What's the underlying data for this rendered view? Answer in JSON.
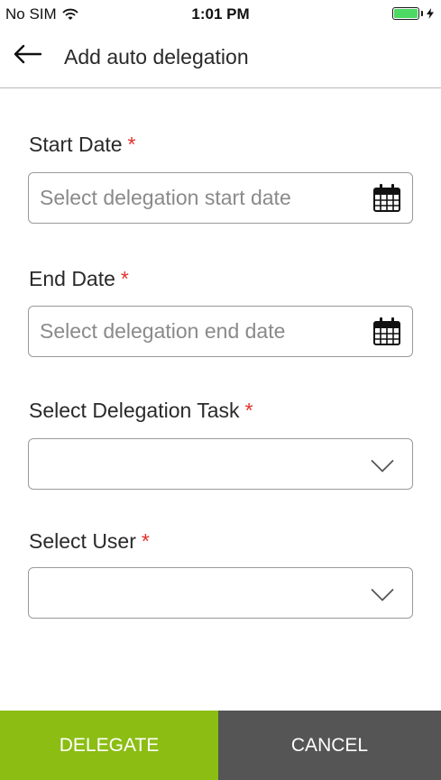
{
  "status_bar": {
    "carrier": "No SIM",
    "time": "1:01 PM",
    "wifi_icon": "wifi-icon",
    "battery_icon": "battery-charging-icon",
    "battery_color": "#4cd964"
  },
  "header": {
    "back_icon": "arrow-left-icon",
    "title": "Add auto delegation"
  },
  "form": {
    "required_marker": "*",
    "required_color": "#e4322b",
    "start_date": {
      "label": "Start Date",
      "value": "",
      "placeholder": "Select delegation start date",
      "icon": "calendar-icon"
    },
    "end_date": {
      "label": "End Date",
      "value": "",
      "placeholder": "Select delegation end date",
      "icon": "calendar-icon"
    },
    "delegation_task": {
      "label": "Select Delegation Task",
      "value": "",
      "icon": "chevron-down-icon"
    },
    "user": {
      "label": "Select User",
      "value": "",
      "icon": "chevron-down-icon"
    }
  },
  "footer": {
    "delegate_label": "DELEGATE",
    "delegate_color": "#8bbd13",
    "cancel_label": "CANCEL",
    "cancel_color": "#555555"
  }
}
